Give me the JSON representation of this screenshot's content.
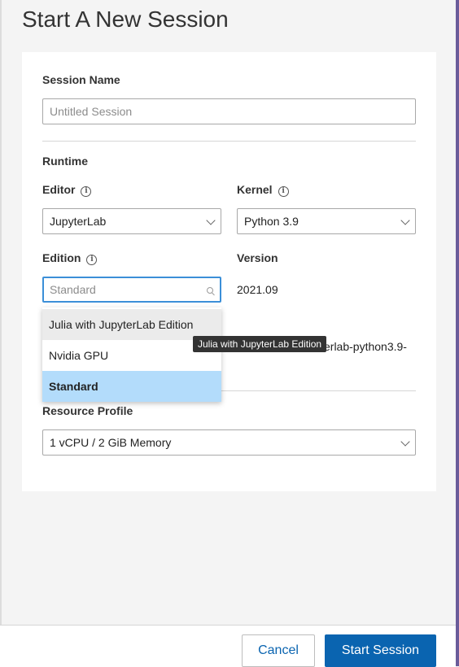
{
  "modal": {
    "title": "Start A New Session"
  },
  "session_name": {
    "label": "Session Name",
    "placeholder": "Untitled Session"
  },
  "runtime": {
    "heading": "Runtime",
    "editor": {
      "label": "Editor",
      "value": "JupyterLab"
    },
    "kernel": {
      "label": "Kernel",
      "value": "Python 3.9"
    },
    "edition": {
      "label": "Edition",
      "placeholder": "Standard",
      "options": [
        "Julia with JupyterLab Edition",
        "Nvidia GPU",
        "Standard"
      ],
      "hovered_option": "Julia with JupyterLab Edition",
      "selected_option": "Standard"
    },
    "version": {
      "label": "Version",
      "value": "2021.09"
    },
    "partial_text": "erlab-python3.9-",
    "tooltip": "Julia with JupyterLab Edition"
  },
  "resource_profile": {
    "label": "Resource Profile",
    "value": "1 vCPU / 2 GiB Memory"
  },
  "footer": {
    "cancel_label": "Cancel",
    "start_label": "Start Session"
  },
  "colors": {
    "accent": "#0a64b0",
    "selected_option_bg": "#b3dcfb",
    "hover_option_bg": "#ebebeb"
  },
  "icons": [
    "info-icon",
    "chevron-down-icon",
    "search-icon"
  ]
}
